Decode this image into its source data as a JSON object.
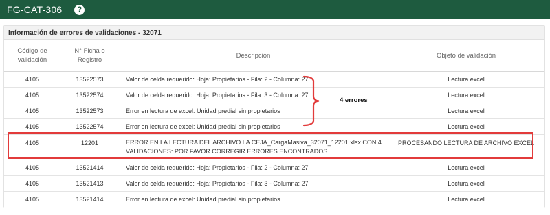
{
  "app": {
    "title": "FG-CAT-306",
    "help_icon": "question-circle-icon"
  },
  "panel": {
    "title": "Información de errores de validaciones - 32071"
  },
  "table": {
    "headers": {
      "code": [
        "Código de",
        "validación"
      ],
      "ficha": [
        "N° Ficha o",
        "Registro"
      ],
      "description": "Descripción",
      "object": "Objeto de validación"
    },
    "rows": [
      {
        "code": "4105",
        "ficha": "13522573",
        "description": "Valor de celda requerido: Hoja: Propietarios - Fila: 2 - Columna: 27",
        "object": "Lectura excel"
      },
      {
        "code": "4105",
        "ficha": "13522574",
        "description": "Valor de celda requerido: Hoja: Propietarios - Fila: 3 - Columna: 27",
        "object": "Lectura excel"
      },
      {
        "code": "4105",
        "ficha": "13522573",
        "description": "Error en lectura de excel: Unidad predial sin propietarios",
        "object": "Lectura excel"
      },
      {
        "code": "4105",
        "ficha": "13522574",
        "description": "Error en lectura de excel: Unidad predial sin propietarios",
        "object": "Lectura excel"
      },
      {
        "code": "4105",
        "ficha": "12201",
        "description": "ERROR EN LA LECTURA DEL ARCHIVO LA CEJA_CargaMasiva_32071_12201.xlsx CON 4 VALIDACIONES: POR FAVOR CORREGIR ERRORES ENCONTRADOS",
        "object": "PROCESANDO LECTURA DE ARCHIVO EXCEL"
      },
      {
        "code": "4105",
        "ficha": "13521414",
        "description": "Valor de celda requerido: Hoja: Propietarios - Fila: 2 - Columna: 27",
        "object": "Lectura excel"
      },
      {
        "code": "4105",
        "ficha": "13521413",
        "description": "Valor de celda requerido: Hoja: Propietarios - Fila: 3 - Columna: 27",
        "object": "Lectura excel"
      },
      {
        "code": "4105",
        "ficha": "13521414",
        "description": "Error en lectura de excel: Unidad predial sin propietarios",
        "object": "Lectura excel"
      }
    ]
  },
  "annotations": {
    "brace_label": "4 errores",
    "highlight_color": "#e23b3b"
  },
  "colors": {
    "topbar": "#1e5b3f"
  }
}
